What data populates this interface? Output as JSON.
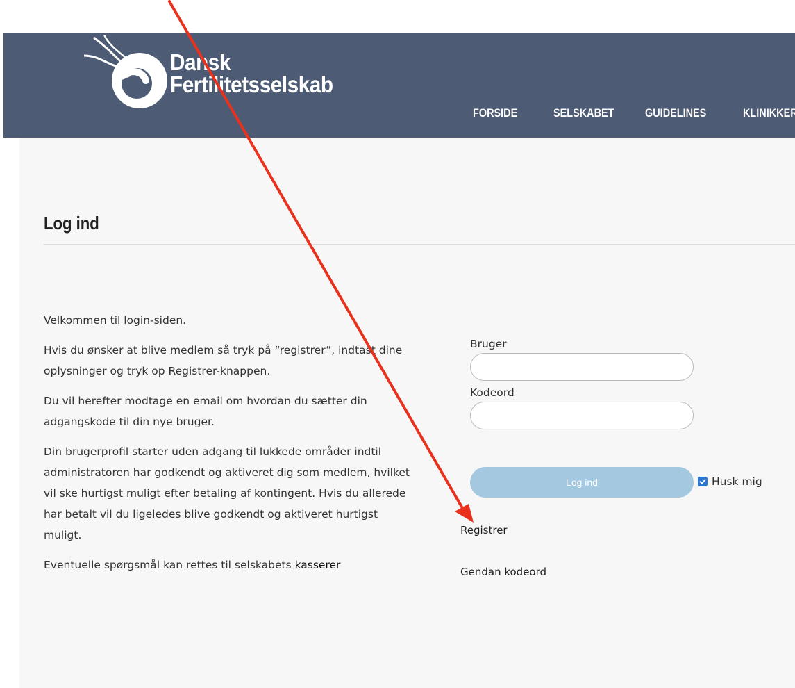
{
  "brand": {
    "line1": "Dansk",
    "line2": "Fertilitetsselskab"
  },
  "nav": {
    "items": [
      "FORSIDE",
      "SELSKABET",
      "GUIDELINES",
      "KLINIKKER"
    ]
  },
  "page": {
    "title": "Log ind"
  },
  "intro": {
    "p1": "Velkommen til login-siden.",
    "p2": "Hvis du ønsker at blive medlem så tryk på “registrer”, indtast dine oplysninger og tryk op Registrer-knappen.",
    "p3": "Du vil herefter modtage en email om hvordan du sætter din adgangskode til din nye bruger.",
    "p4": "Din brugerprofil starter uden adgang til lukkede områder indtil administratoren har godkendt og  aktiveret dig som medlem, hvilket vil ske hurtigst muligt efter betaling af kontingent. Hvis du allerede har betalt vil du ligeledes blive godkendt og aktiveret hurtigst muligt.",
    "p5_text": "Eventuelle spørgsmål kan rettes til selskabets ",
    "p5_link": "kasserer"
  },
  "form": {
    "user_label": "Bruger",
    "user_value": "",
    "password_label": "Kodeord",
    "password_value": "",
    "login_button": "Log ind",
    "remember_label": "Husk mig",
    "remember_checked": true,
    "register_link": "Registrer",
    "reset_link": "Gendan kodeord"
  },
  "colors": {
    "header_bg": "#4d5b74",
    "content_bg": "#f7f7f7",
    "login_button": "#a3c8e0",
    "checkbox": "#2f76d2",
    "annotation_arrow": "#e8321e"
  }
}
